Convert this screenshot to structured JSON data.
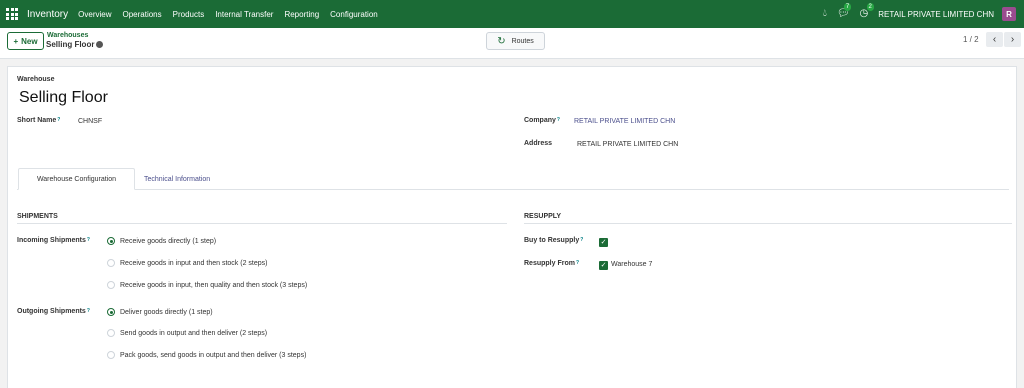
{
  "navbar": {
    "app_name": "Inventory",
    "menu": [
      "Overview",
      "Operations",
      "Products",
      "Internal Transfer",
      "Reporting",
      "Configuration"
    ],
    "chat_badge": "7",
    "activity_badge": "2",
    "company": "RETAIL PRIVATE LIMITED CHN",
    "avatar_letter": "R",
    "color": "#1b6b36"
  },
  "control": {
    "new_label": "New",
    "breadcrumb_parent": "Warehouses",
    "breadcrumb_current": "Selling Floor",
    "routes_label": "Routes",
    "pager": "1 / 2"
  },
  "form": {
    "record_label": "Warehouse",
    "title": "Selling Floor",
    "short_name_label": "Short Name",
    "short_name_value": "CHNSF",
    "company_label": "Company",
    "company_value": "RETAIL PRIVATE LIMITED CHN",
    "address_label": "Address",
    "address_value": "RETAIL PRIVATE LIMITED CHN"
  },
  "tabs": [
    "Warehouse Configuration",
    "Technical Information"
  ],
  "shipments": {
    "title": "SHIPMENTS",
    "incoming_label": "Incoming Shipments",
    "incoming_options": [
      "Receive goods directly (1 step)",
      "Receive goods in input and then stock (2 steps)",
      "Receive goods in input, then quality and then stock (3 steps)"
    ],
    "incoming_selected": 0,
    "outgoing_label": "Outgoing Shipments",
    "outgoing_options": [
      "Deliver goods directly (1 step)",
      "Send goods in output and then deliver (2 steps)",
      "Pack goods, send goods in output and then deliver (3 steps)"
    ],
    "outgoing_selected": 0
  },
  "resupply": {
    "title": "RESUPPLY",
    "buy_label": "Buy to Resupply",
    "buy_checked": true,
    "from_label": "Resupply From",
    "from_value": "Warehouse 7",
    "from_checked": true
  }
}
